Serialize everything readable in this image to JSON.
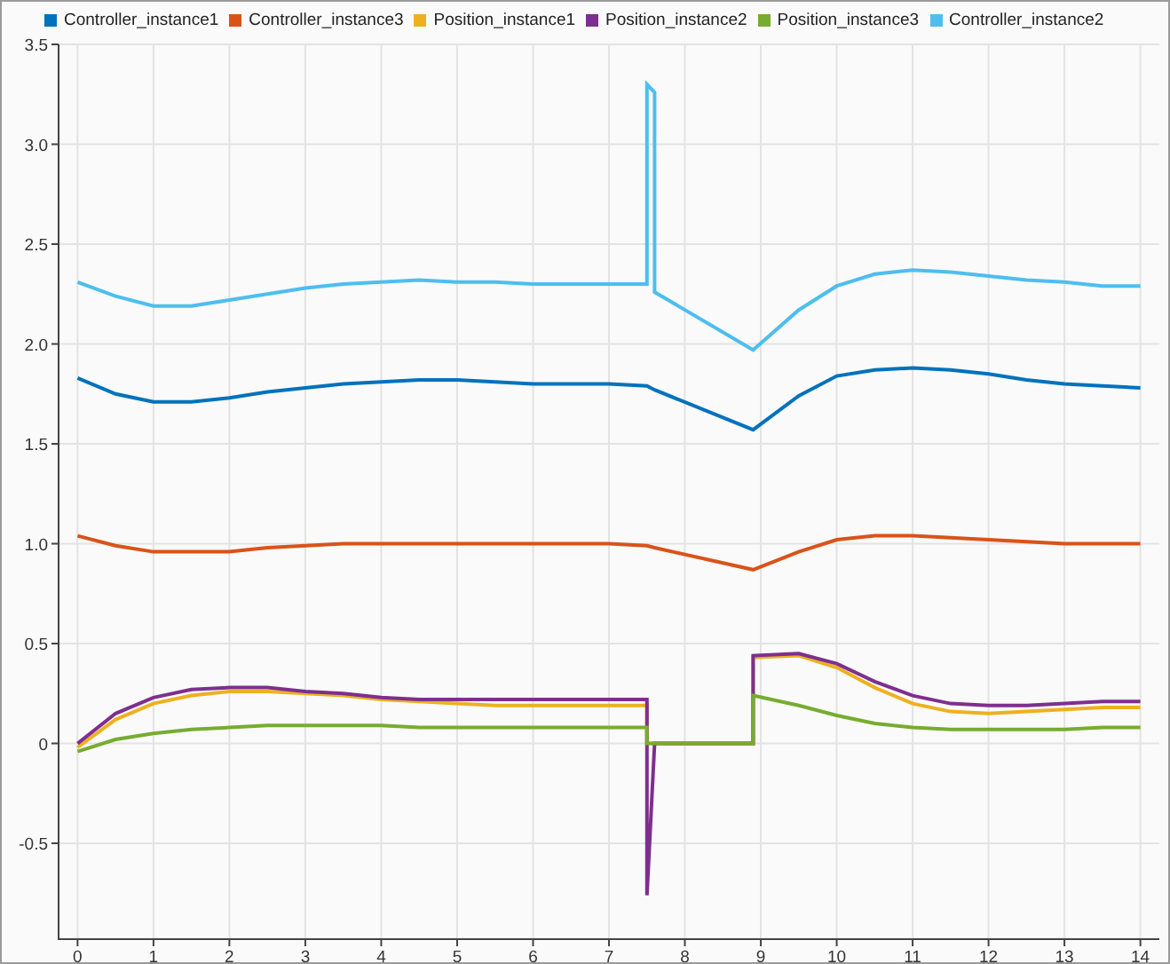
{
  "chart_data": {
    "type": "line",
    "grid": true,
    "legend": true,
    "x": [
      0,
      0.5,
      1,
      1.5,
      2,
      2.5,
      3,
      3.5,
      4,
      4.5,
      5,
      5.5,
      6,
      6.5,
      7,
      7.5,
      7.5,
      7.6,
      7.6,
      8.9,
      8.9,
      9.5,
      10,
      10.5,
      11,
      11.5,
      12,
      12.5,
      13,
      13.5,
      14
    ],
    "xlim": [
      -0.25,
      14.25
    ],
    "ylim": [
      -0.98,
      3.5
    ],
    "xticks": [
      0,
      1,
      2,
      3,
      4,
      5,
      6,
      7,
      8,
      9,
      10,
      11,
      12,
      13,
      14
    ],
    "yticks": [
      -0.5,
      0,
      0.5,
      {
        "value": 1,
        "label": "1.0"
      },
      1.5,
      {
        "value": 2,
        "label": "2.0"
      },
      2.5,
      {
        "value": 3,
        "label": "3.0"
      },
      3.5
    ],
    "series": [
      {
        "name": "Controller_instance1",
        "color": "#0072bd",
        "values": [
          1.83,
          1.75,
          1.71,
          1.71,
          1.73,
          1.76,
          1.78,
          1.8,
          1.81,
          1.82,
          1.82,
          1.81,
          1.8,
          1.8,
          1.8,
          1.79,
          1.79,
          1.77,
          1.77,
          1.57,
          1.57,
          1.74,
          1.84,
          1.87,
          1.88,
          1.87,
          1.85,
          1.82,
          1.8,
          1.79,
          1.78
        ]
      },
      {
        "name": "Controller_instance3",
        "color": "#d95319",
        "values": [
          1.04,
          0.99,
          0.96,
          0.96,
          0.96,
          0.98,
          0.99,
          1.0,
          1.0,
          1.0,
          1.0,
          1.0,
          1.0,
          1.0,
          1.0,
          0.99,
          0.99,
          0.98,
          0.98,
          0.87,
          0.87,
          0.96,
          1.02,
          1.04,
          1.04,
          1.03,
          1.02,
          1.01,
          1.0,
          1.0,
          1.0
        ]
      },
      {
        "name": "Position_instance1",
        "color": "#edb120",
        "values": [
          -0.02,
          0.12,
          0.2,
          0.24,
          0.26,
          0.26,
          0.25,
          0.24,
          0.22,
          0.21,
          0.2,
          0.19,
          0.19,
          0.19,
          0.19,
          0.19,
          0,
          0,
          0,
          0,
          0.43,
          0.44,
          0.38,
          0.28,
          0.2,
          0.16,
          0.15,
          0.16,
          0.17,
          0.18,
          0.18
        ]
      },
      {
        "name": "Position_instance2",
        "color": "#7e2f8e",
        "values": [
          0,
          0.15,
          0.23,
          0.27,
          0.28,
          0.28,
          0.26,
          0.25,
          0.23,
          0.22,
          0.22,
          0.22,
          0.22,
          0.22,
          0.22,
          0.22,
          -0.76,
          0,
          0,
          0,
          0.44,
          0.45,
          0.4,
          0.31,
          0.24,
          0.2,
          0.19,
          0.19,
          0.2,
          0.21,
          0.21
        ]
      },
      {
        "name": "Position_instance3",
        "color": "#77ac30",
        "values": [
          -0.04,
          0.02,
          0.05,
          0.07,
          0.08,
          0.09,
          0.09,
          0.09,
          0.09,
          0.08,
          0.08,
          0.08,
          0.08,
          0.08,
          0.08,
          0.08,
          0,
          0,
          0,
          0,
          0.24,
          0.19,
          0.14,
          0.1,
          0.08,
          0.07,
          0.07,
          0.07,
          0.07,
          0.08,
          0.08
        ]
      },
      {
        "name": "Controller_instance2",
        "color": "#4dbeee",
        "values": [
          2.31,
          2.24,
          2.19,
          2.19,
          2.22,
          2.25,
          2.28,
          2.3,
          2.31,
          2.32,
          2.31,
          2.31,
          2.3,
          2.3,
          2.3,
          2.3,
          3.3,
          3.26,
          2.26,
          1.97,
          1.97,
          2.17,
          2.29,
          2.35,
          2.37,
          2.36,
          2.34,
          2.32,
          2.31,
          2.29,
          2.29
        ]
      }
    ]
  }
}
